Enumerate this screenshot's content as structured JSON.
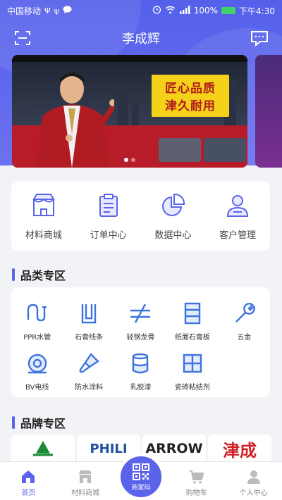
{
  "status_bar": {
    "carrier": "中国移动",
    "battery_label": "100%",
    "time": "下午4:30"
  },
  "header": {
    "title": "李成辉"
  },
  "banner": {
    "slogan_line1": "匠心品质",
    "slogan_line2": "津久耐用",
    "page_count": 2,
    "active_index": 0
  },
  "functions": [
    {
      "label": "材料商城",
      "icon": "store-icon"
    },
    {
      "label": "订单中心",
      "icon": "clipboard-icon"
    },
    {
      "label": "数据中心",
      "icon": "pie-chart-icon"
    },
    {
      "label": "客户管理",
      "icon": "user-icon"
    }
  ],
  "category_section": {
    "title": "品类专区",
    "items": [
      {
        "label": "PPR水管",
        "icon": "pipe-icon"
      },
      {
        "label": "石膏线条",
        "icon": "gypsum-line-icon"
      },
      {
        "label": "轻钢龙骨",
        "icon": "steel-keel-icon"
      },
      {
        "label": "纸面石膏板",
        "icon": "gypsum-board-icon"
      },
      {
        "label": "五金",
        "icon": "wrench-icon"
      },
      {
        "label": "BV电线",
        "icon": "wire-icon"
      },
      {
        "label": "防水涂料",
        "icon": "brush-icon"
      },
      {
        "label": "乳胶漆",
        "icon": "paint-bucket-icon"
      },
      {
        "label": "瓷砖粘结剂",
        "icon": "tile-icon"
      }
    ]
  },
  "brand_section": {
    "title": "品牌专区",
    "brands": [
      {
        "text": "",
        "color": "#1d8a3a"
      },
      {
        "text": "PHILI",
        "color": "#1f4fa0"
      },
      {
        "text": "ARROW",
        "color": "#222222"
      },
      {
        "text": "津成",
        "color": "#d01f25"
      }
    ]
  },
  "bottom_nav": {
    "home": "首页",
    "mall": "材料商城",
    "merchant_code": "商家码",
    "cart": "购物车",
    "profile": "个人中心"
  },
  "colors": {
    "accent": "#5a63ea",
    "header_bg": "#5560ea"
  }
}
